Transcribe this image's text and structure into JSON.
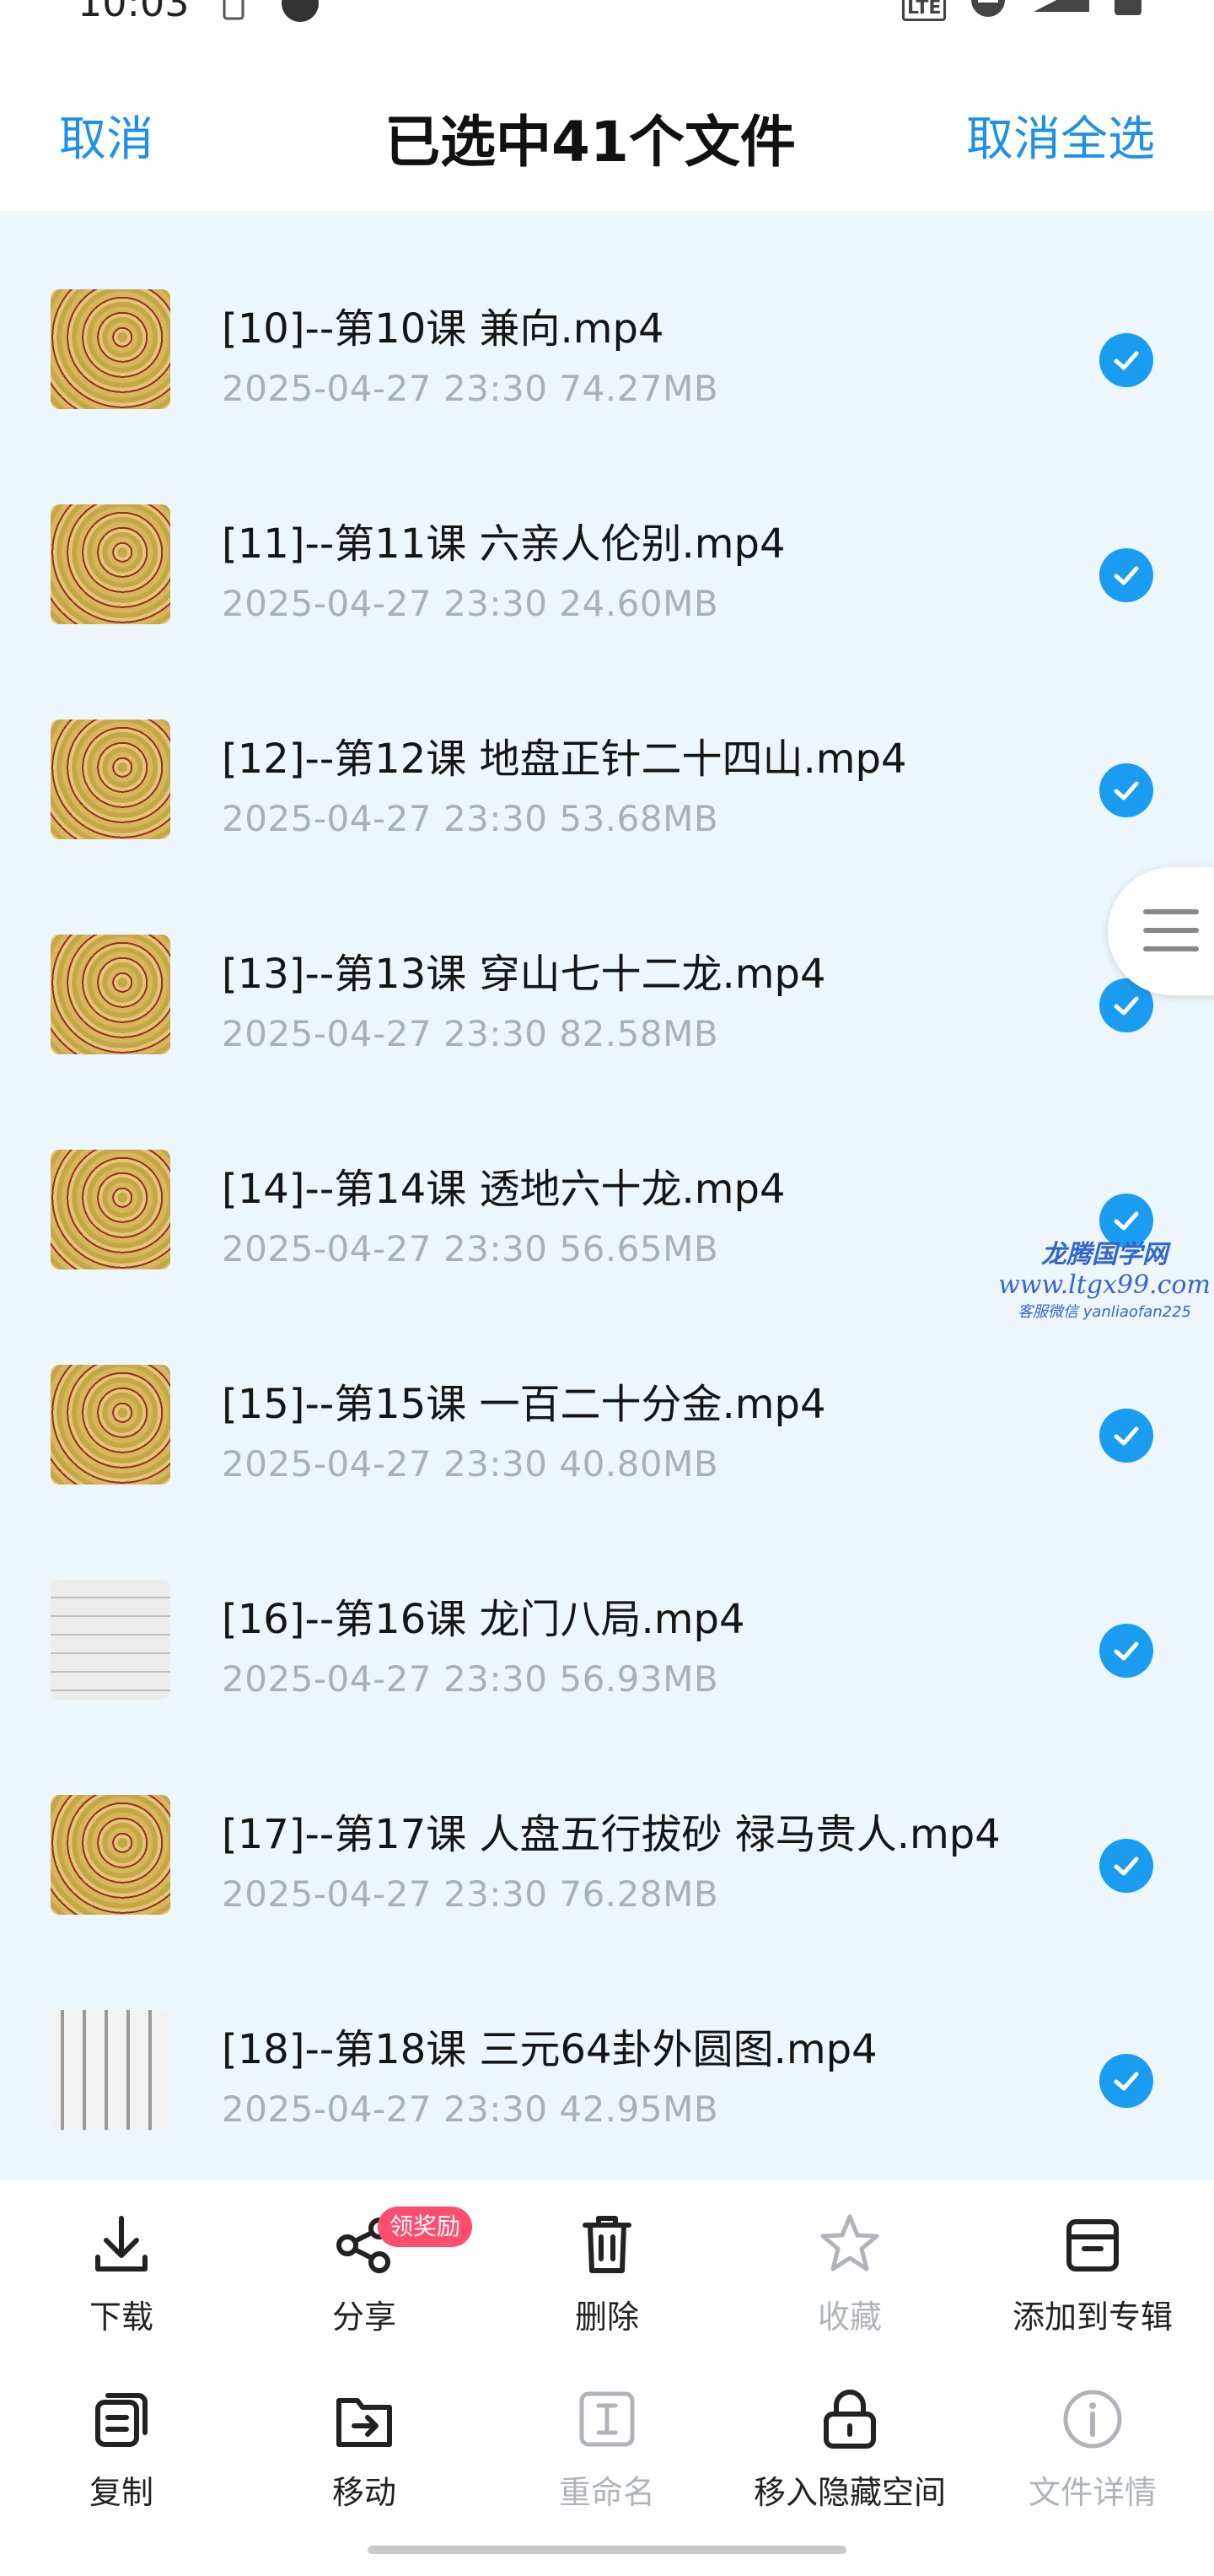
{
  "status": {
    "time": "10:03",
    "network": "LTE"
  },
  "header": {
    "left": "取消",
    "title": "已选中41个文件",
    "right": "取消全选"
  },
  "files": [
    {
      "name": "[10]--第10课 兼向.mp4",
      "date": "2025-04-27",
      "time": "23:30",
      "size": "74.27MB",
      "thumb": "compass"
    },
    {
      "name": "[11]--第11课 六亲人伦别.mp4",
      "date": "2025-04-27",
      "time": "23:30",
      "size": "24.60MB",
      "thumb": "compass"
    },
    {
      "name": "[12]--第12课 地盘正针二十四山.mp4",
      "date": "2025-04-27",
      "time": "23:30",
      "size": "53.68MB",
      "thumb": "compass"
    },
    {
      "name": "[13]--第13课 穿山七十二龙.mp4",
      "date": "2025-04-27",
      "time": "23:30",
      "size": "82.58MB",
      "thumb": "compass"
    },
    {
      "name": "[14]--第14课 透地六十龙.mp4",
      "date": "2025-04-27",
      "time": "23:30",
      "size": "56.65MB",
      "thumb": "compass"
    },
    {
      "name": "[15]--第15课 一百二十分金.mp4",
      "date": "2025-04-27",
      "time": "23:30",
      "size": "40.80MB",
      "thumb": "compass"
    },
    {
      "name": "[16]--第16课 龙门八局.mp4",
      "date": "2025-04-27",
      "time": "23:30",
      "size": "56.93MB",
      "thumb": "doc"
    },
    {
      "name": "[17]--第17课 人盘五行拔砂 禄马贵人.mp4",
      "date": "2025-04-27",
      "time": "23:30",
      "size": "76.28MB",
      "thumb": "compass"
    },
    {
      "name": "[18]--第18课 三元64卦外圆图.mp4",
      "date": "2025-04-27",
      "time": "23:30",
      "size": "42.95MB",
      "thumb": "doc2"
    }
  ],
  "watermark": {
    "line1": "龙腾国学网",
    "line2": "www.ltgx99.com",
    "line3": "客服微信 yanliaofan225"
  },
  "toolbar": {
    "download": "下载",
    "share": "分享",
    "share_badge": "领奖励",
    "delete": "删除",
    "favorite": "收藏",
    "add_album": "添加到专辑",
    "copy": "复制",
    "move": "移动",
    "rename": "重命名",
    "hide": "移入隐藏空间",
    "details": "文件详情"
  },
  "colors": {
    "accent": "#1e90e8",
    "list_bg": "#eef6fd",
    "check": "#1a9cf0",
    "badge": "#ff4d6d"
  }
}
